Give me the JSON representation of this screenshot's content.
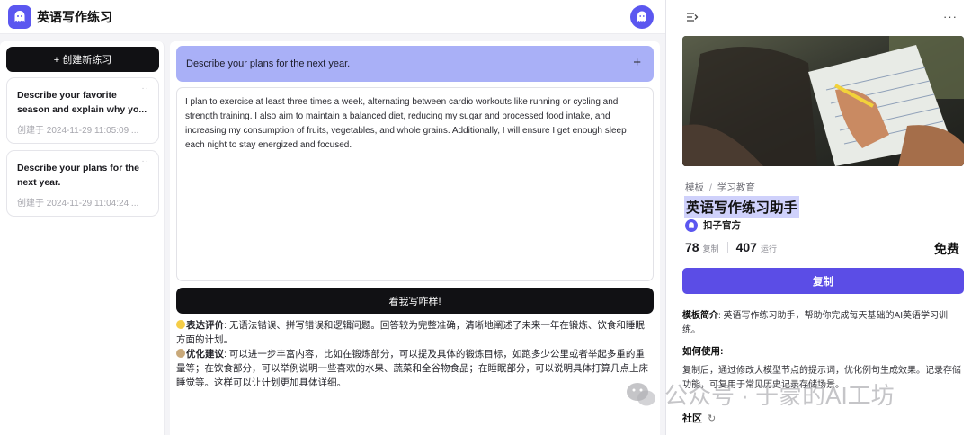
{
  "app": {
    "title": "英语写作练习",
    "logo_icon": "ghost-logo-icon",
    "accent": "#5b57f0"
  },
  "sidebar": {
    "new_button_label": "+ 创建新练习",
    "history": [
      {
        "title": "Describe your favorite season and explain why yo...",
        "date": "创建于 2024-11-29 11:05:09 ..."
      },
      {
        "title": "Describe your plans for the next year.",
        "date": "创建于 2024-11-29 11:04:24 ..."
      }
    ]
  },
  "main": {
    "prompt": "Describe your plans for the next year.",
    "prompt_plus": "+",
    "essay": "I plan to exercise at least three times a week, alternating between cardio workouts like running or cycling and strength training. I also aim to maintain a balanced diet, reducing my sugar and processed food intake, and increasing my consumption of fruits, vegetables, and whole grains. Additionally, I will ensure I get enough sleep each night to stay energized and focused.",
    "check_button_label": "看我写咋样!",
    "feedback": {
      "expression_label": "表达评价",
      "expression_text": ": 无语法错误、拼写错误和逻辑问题。回答较为完整准确，清晰地阐述了未来一年在锻炼、饮食和睡眠方面的计划。",
      "suggestion_label": "优化建议",
      "suggestion_text": ": 可以进一步丰富内容，比如在锻炼部分，可以提及具体的锻炼目标，如跑多少公里或者举起多重的重量等；在饮食部分，可以举例说明一些喜欢的水果、蔬菜和全谷物食品；在睡眠部分，可以说明具体打算几点上床睡觉等。这样可以让计划更加具体详细。"
    }
  },
  "panel": {
    "breadcrumb": [
      "模板",
      "学习教育"
    ],
    "breadcrumb_sep": "/",
    "title": "英语写作练习助手",
    "author": "扣子官方",
    "copies": "78",
    "copies_label": "复制",
    "runs": "407",
    "runs_label": "运行",
    "price": "免费",
    "copy_button_label": "复制",
    "intro_label": "模板简介",
    "intro_text": ": 英语写作练习助手，帮助你完成每天基础的AI英语学习训练。",
    "howto_heading": "如何使用:",
    "howto_text": "复制后，通过修改大模型节点的提示词，优化例句生成效果。记录存储功能，可复用于常见历史记录存储场景。",
    "community_label": "社区",
    "button_color": "#5b4de6"
  },
  "watermark": {
    "text": "公众号 · 于蒙的AI工坊"
  }
}
